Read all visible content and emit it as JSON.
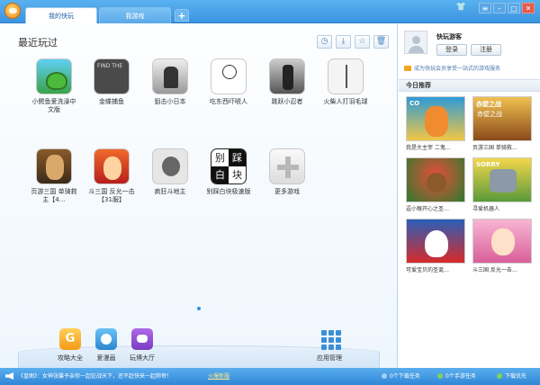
{
  "titlebar": {
    "tabs": [
      {
        "label": "我的快玩"
      },
      {
        "label": "我游戏"
      }
    ],
    "plus_label": "+",
    "win": {
      "menu": "≡",
      "min": "–",
      "max": "□",
      "close": "✕"
    }
  },
  "main": {
    "title": "最近玩过",
    "games_row1": [
      {
        "label": "小鳄鱼爱洗澡中文版",
        "icon": "swamp"
      },
      {
        "label": "金蝶捕鱼",
        "icon": "fish"
      },
      {
        "label": "狙击小日本",
        "icon": "ninja"
      },
      {
        "label": "吃东西吓唬人",
        "icon": "sketch"
      },
      {
        "label": "跳跃小忍者",
        "icon": "jump"
      },
      {
        "label": "火柴人打羽毛球",
        "icon": "stick"
      }
    ],
    "games_row2": [
      {
        "label": "页游三国 单骑救主【4…",
        "icon": "three"
      },
      {
        "label": "斗三国 反允一击【31服】",
        "icon": "dou"
      },
      {
        "label": "疯狂斗地主",
        "icon": "crazy"
      },
      {
        "label": "别踩白块极速版",
        "icon": "white"
      },
      {
        "label": "更多游戏",
        "icon": "more"
      }
    ],
    "white_tile": [
      "别",
      "踩",
      "白",
      "块"
    ],
    "dock": [
      {
        "label": "攻略大全",
        "glyph": "G"
      },
      {
        "label": "爱漫画",
        "glyph": ""
      },
      {
        "label": "玩博大厅",
        "glyph": ""
      },
      {
        "label": "应用管理",
        "glyph": ""
      }
    ]
  },
  "side": {
    "username": "快玩游客",
    "login": "登录",
    "register": "注册",
    "vip_text": "成为快玩会员享受一站式的游戏服务",
    "rec_title": "今日推荐",
    "recs": [
      {
        "label": "我是大主宰 二鬼…"
      },
      {
        "label": "页游三国 单骑救…"
      },
      {
        "label": "逗小猴开心之圣…"
      },
      {
        "label": "寻爱机器人"
      },
      {
        "label": "可爱宝贝的圣诞…"
      },
      {
        "label": "斗三国 反允一击…"
      }
    ],
    "rec_text": [
      "CO",
      "赤壁之战",
      "",
      "SORRY",
      "",
      ""
    ]
  },
  "status": {
    "ticker": "《皇图》：女神张馨予亲你一起征战天下，还不赶快来一起称帝！",
    "news": "火爆新服",
    "downloads": "0个下载任务",
    "mobile": "0个手游任务",
    "priority": "下载优先"
  }
}
